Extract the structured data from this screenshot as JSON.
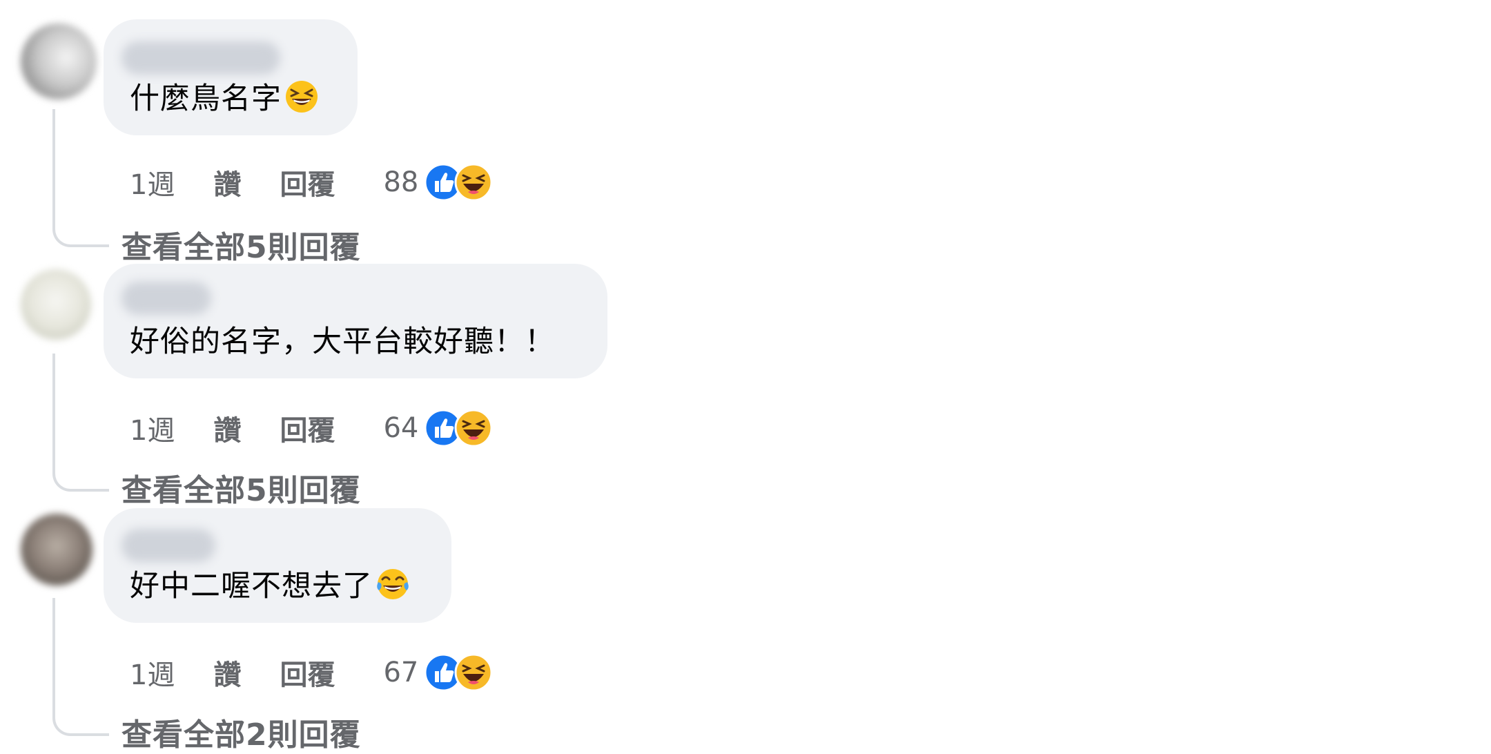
{
  "colors": {
    "bubble": "#f0f2f5",
    "secondary_text": "#65676b",
    "like_blue": "#1877f2",
    "haha_yellow": "#f7b928"
  },
  "comments": [
    {
      "text": "什麼鳥名字",
      "text_emoji": "grinning-squinting-face-icon",
      "time": "1週",
      "like_label": "讚",
      "reply_label": "回覆",
      "reaction_count": "88",
      "reactions": [
        "like-icon",
        "haha-icon"
      ],
      "view_replies": "查看全部5則回覆"
    },
    {
      "text": "好俗的名字，大平台較好聽！！",
      "text_emoji": "",
      "time": "1週",
      "like_label": "讚",
      "reply_label": "回覆",
      "reaction_count": "64",
      "reactions": [
        "like-icon",
        "haha-icon"
      ],
      "view_replies": "查看全部5則回覆"
    },
    {
      "text": "好中二喔不想去了",
      "text_emoji": "tears-of-joy-face-icon",
      "time": "1週",
      "like_label": "讚",
      "reply_label": "回覆",
      "reaction_count": "67",
      "reactions": [
        "like-icon",
        "haha-icon"
      ],
      "view_replies": "查看全部2則回覆"
    }
  ]
}
